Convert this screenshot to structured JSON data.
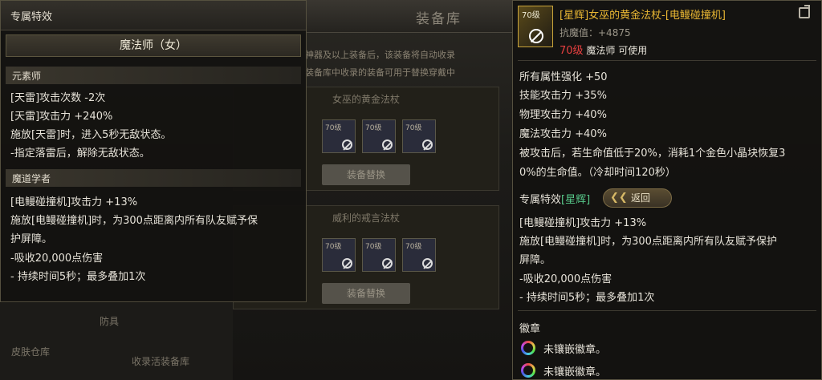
{
  "background": {
    "title": "装备库",
    "info_line1": "神器及以上装备后，该装备将自动收录",
    "info_line2": "装备库中收录的装备可用于替换穿戴中",
    "panel1_title": "女巫的黄金法杖",
    "panel2_title": "威利的戒言法杖",
    "slot_level": "70级",
    "swap_button": "装备替换",
    "side_items": [
      "防具",
      "皮肤仓库",
      "收录活装备库"
    ]
  },
  "left_panel": {
    "header": "专属特效",
    "class_name": "魔法师（女）",
    "sections": [
      {
        "title": "元素师",
        "lines": [
          "[天雷]攻击次数 -2次",
          "[天雷]攻击力 +240%",
          "施放[天雷]时，进入5秒无敌状态。",
          "-指定落雷后，解除无敌状态。"
        ]
      },
      {
        "title": "魔道学者",
        "lines": [
          "[电鳗碰撞机]攻击力 +13%",
          "施放[电鳗碰撞机]时，为300点距离内所有队友赋予保",
          "护屏障。",
          "-吸收20,000点伤害",
          "- 持续时间5秒；最多叠加1次"
        ]
      }
    ]
  },
  "right_panel": {
    "icon_level": "70级",
    "item_name": "[星辉]女巫的黄金法杖-[电鳗碰撞机]",
    "resist_label": "抗魔值：+4875",
    "req_level": "70级",
    "req_class": "魔法师 可使用",
    "stats": [
      "所有属性强化 +50",
      "技能攻击力 +35%",
      "物理攻击力 +40%",
      "魔法攻击力 +40%",
      "被攻击后，若生命值低于20%，消耗1个金色小晶块恢复3",
      "0%的生命值。（冷却时间120秒）"
    ],
    "special_label": "专属特效",
    "special_tag": "[星辉]",
    "return_chevron": "❮❮",
    "return_label": "返回",
    "special_lines": [
      "[电鳗碰撞机]攻击力 +13%",
      "施放[电鳗碰撞机]时，为300点距离内所有队友赋予保护",
      "屏障。",
      "-吸收20,000点伤害",
      "- 持续时间5秒；最多叠加1次"
    ],
    "emblem_title": "徽章",
    "emblems": [
      "未镶嵌徽章。",
      "未镶嵌徽章。"
    ],
    "colors": {
      "gold": "#e9b733",
      "red": "#e84040",
      "tag_green": "#57c98a"
    }
  }
}
